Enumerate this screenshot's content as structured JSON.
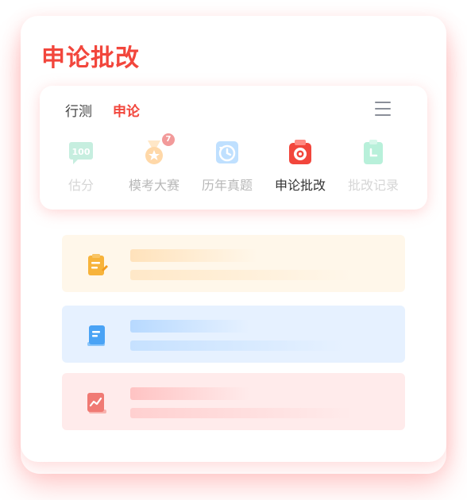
{
  "header": {
    "title": "申论批改"
  },
  "tabs": [
    {
      "label": "行测",
      "active": false
    },
    {
      "label": "申论",
      "active": true
    }
  ],
  "menu": {
    "icon": "menu-icon"
  },
  "functions": [
    {
      "label": "估分",
      "icon": "score-100-icon",
      "color": "#b9e8d6",
      "state": "faded"
    },
    {
      "label": "模考大赛",
      "icon": "medal-icon",
      "color": "#ffd8a8",
      "badge": "7",
      "state": "normal"
    },
    {
      "label": "历年真题",
      "icon": "history-clock-icon",
      "color": "#a9d4ff",
      "state": "normal"
    },
    {
      "label": "申论批改",
      "icon": "camera-correct-icon",
      "color": "#f2463c",
      "state": "active"
    },
    {
      "label": "批改记录",
      "icon": "record-clipboard-icon",
      "color": "#a9ecd1",
      "state": "faded"
    }
  ],
  "list": [
    {
      "icon": "clipboard-edit-icon",
      "color": "#f7b33b",
      "background": "#fff7ea"
    },
    {
      "icon": "book-icon",
      "color": "#4aa3f5",
      "background": "#e6f1ff"
    },
    {
      "icon": "chart-doc-icon",
      "color": "#f07a74",
      "background": "#ffebeb"
    }
  ],
  "colors": {
    "accent": "#f2463c"
  }
}
